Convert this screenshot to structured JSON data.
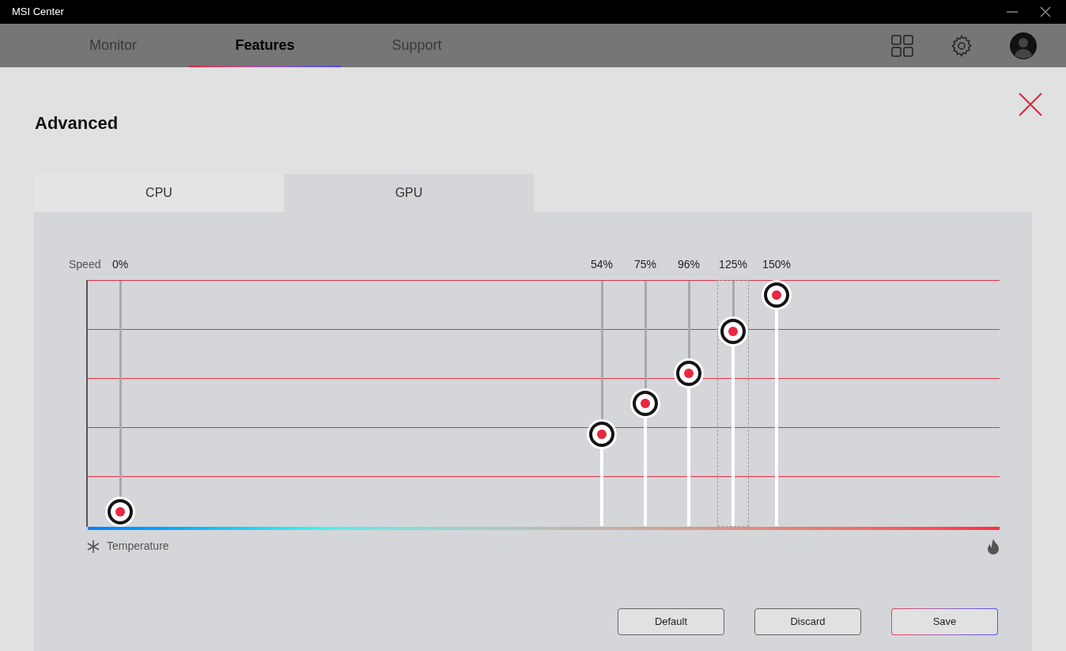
{
  "window": {
    "title": "MSI Center"
  },
  "nav_tabs": [
    {
      "label": "Monitor",
      "selected": false
    },
    {
      "label": "Features",
      "selected": true
    },
    {
      "label": "Support",
      "selected": false
    }
  ],
  "page_title": "Advanced",
  "sub_tabs": [
    {
      "label": "CPU",
      "selected": false
    },
    {
      "label": "GPU",
      "selected": true
    }
  ],
  "fan_curve": {
    "y_label": "Speed",
    "x_label": "Temperature",
    "points": [
      {
        "label": "0%",
        "level": 0.064,
        "selected": false
      },
      {
        "label": "54%",
        "level": 0.378,
        "selected": false
      },
      {
        "label": "75%",
        "level": 0.503,
        "selected": false
      },
      {
        "label": "96%",
        "level": 0.625,
        "selected": false
      },
      {
        "label": "125%",
        "level": 0.795,
        "selected": true
      },
      {
        "label": "150%",
        "level": 0.942,
        "selected": false
      }
    ]
  },
  "buttons": [
    {
      "label": "Default",
      "kind": "plain"
    },
    {
      "label": "Discard",
      "kind": "plain"
    },
    {
      "label": "Save",
      "kind": "primary"
    }
  ]
}
